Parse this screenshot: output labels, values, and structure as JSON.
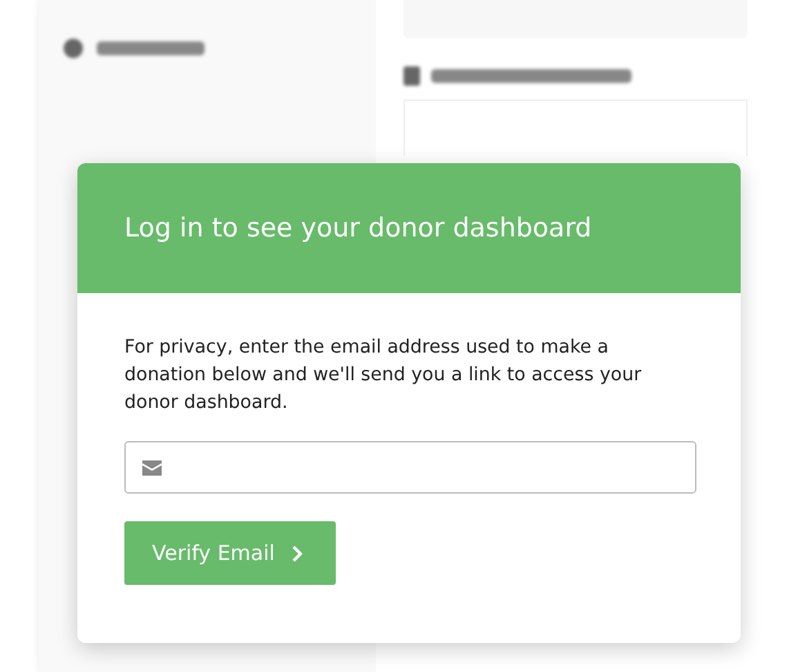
{
  "modal": {
    "title": "Log in to see your donor dashboard",
    "message": "For privacy, enter the email address used to make a donation below and we'll send you a link to access your donor dashboard.",
    "button": "Verify Email"
  }
}
